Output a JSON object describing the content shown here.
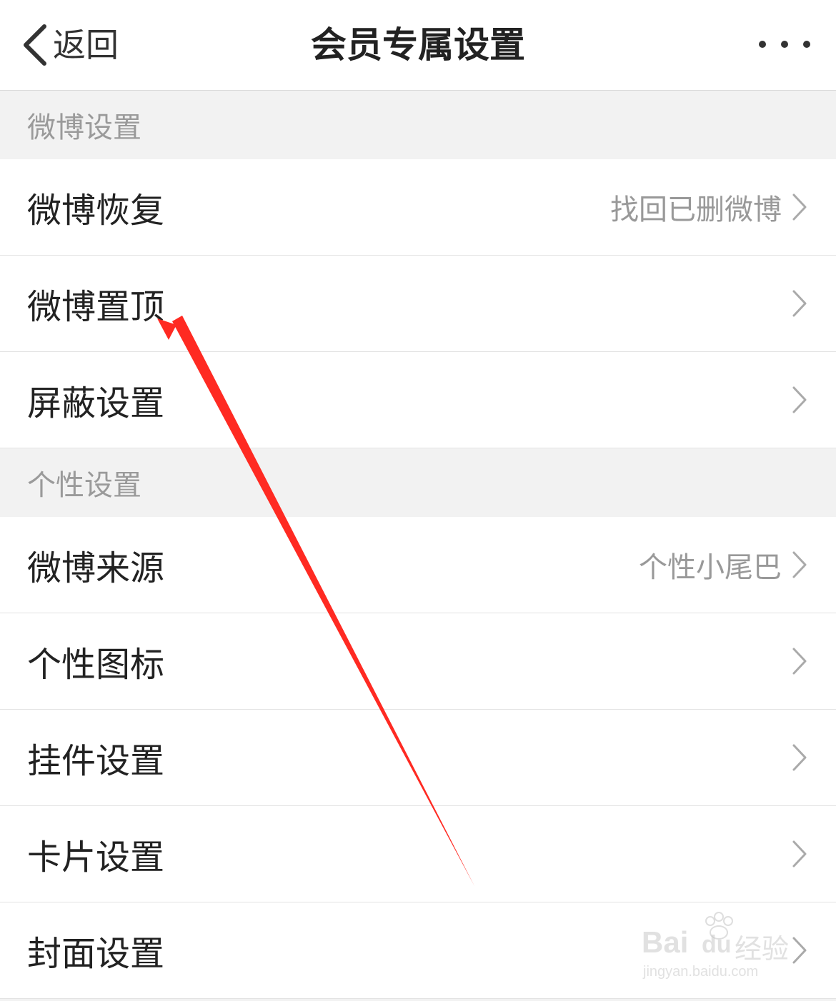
{
  "nav": {
    "back_label": "返回",
    "title": "会员专属设置"
  },
  "sections": [
    {
      "header": "微博设置",
      "items": [
        {
          "label": "微博恢复",
          "detail": "找回已删微博"
        },
        {
          "label": "微博置顶",
          "detail": ""
        },
        {
          "label": "屏蔽设置",
          "detail": ""
        }
      ]
    },
    {
      "header": "个性设置",
      "items": [
        {
          "label": "微博来源",
          "detail": "个性小尾巴"
        },
        {
          "label": "个性图标",
          "detail": ""
        },
        {
          "label": "挂件设置",
          "detail": ""
        },
        {
          "label": "卡片设置",
          "detail": ""
        },
        {
          "label": "封面设置",
          "detail": ""
        }
      ]
    }
  ],
  "watermark": {
    "brand": "Bai",
    "brand_suffix": "du",
    "jingyan": "经验",
    "url": "jingyan.baidu.com"
  },
  "colors": {
    "annotation_arrow": "#ff2a22",
    "section_bg": "#f2f2f2",
    "row_bg": "#ffffff"
  }
}
